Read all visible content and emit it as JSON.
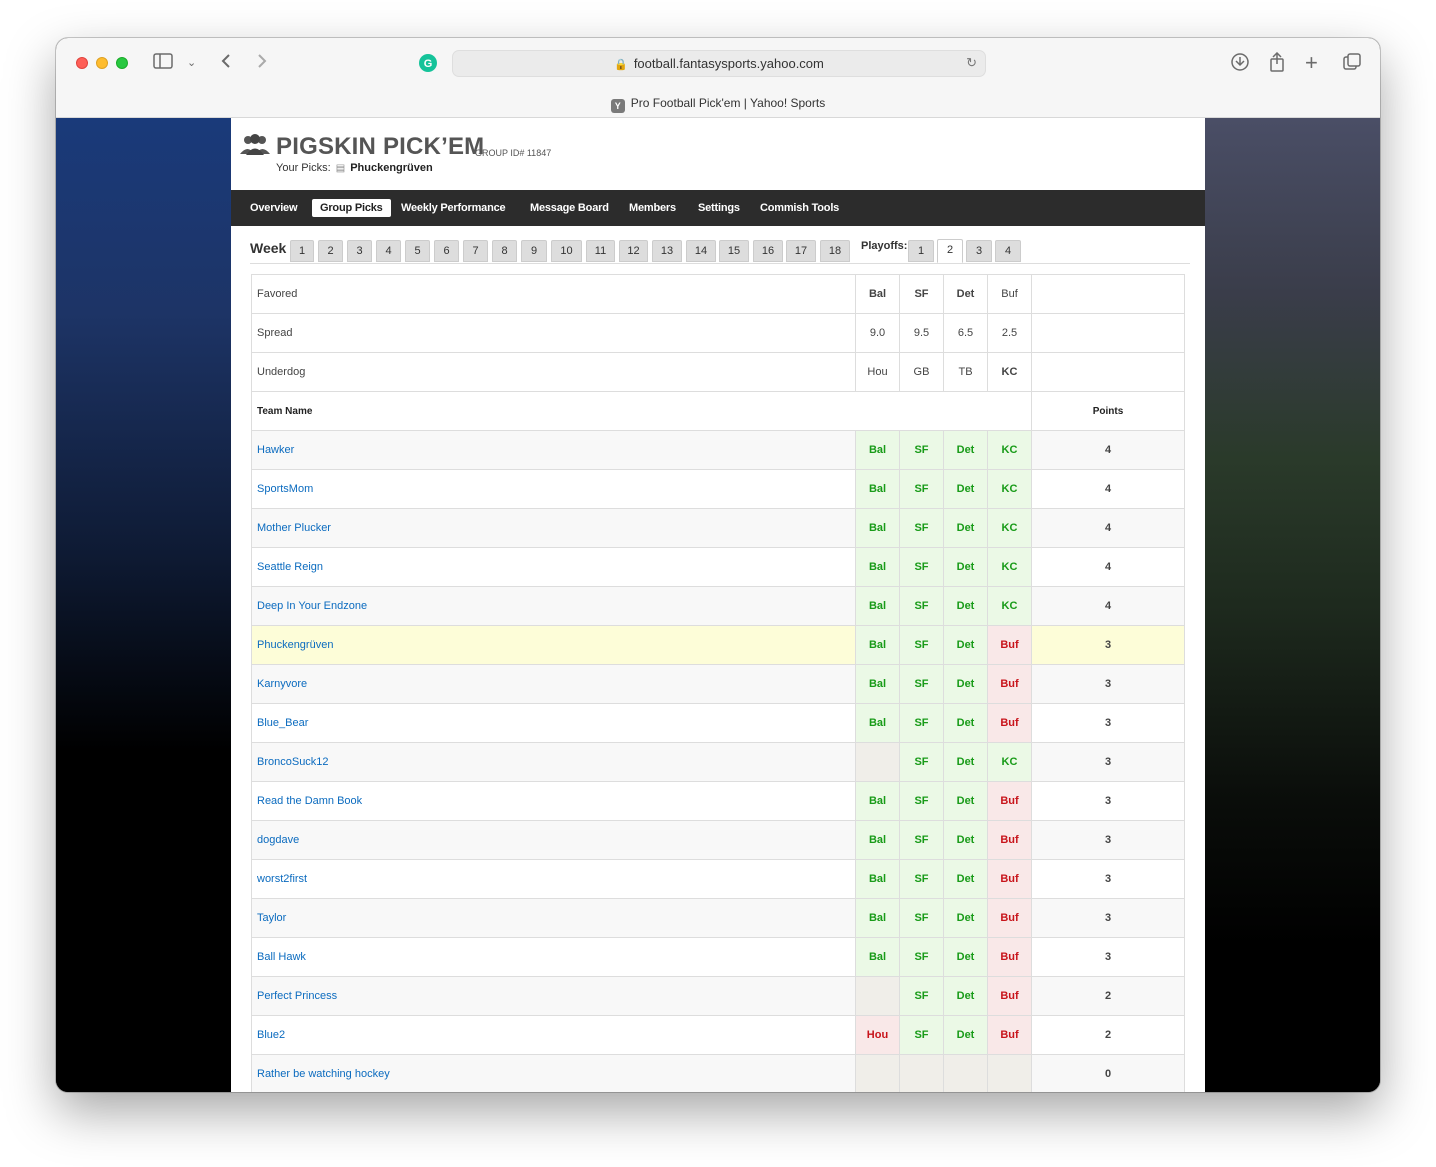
{
  "browser": {
    "url": "football.fantasysports.yahoo.com",
    "tab_title": "Pro Football Pick'em | Yahoo! Sports",
    "favicon_letter": "Y"
  },
  "header": {
    "brand": "PIGSKIN PICK’EM",
    "group_id": "GROUP ID# 11847",
    "your_picks_label": "Your Picks:",
    "your_picks_team": "Phuckengrüven"
  },
  "nav": [
    {
      "label": "Overview",
      "active": false
    },
    {
      "label": "Group Picks",
      "active": true
    },
    {
      "label": "Weekly Performance",
      "active": false
    },
    {
      "label": "Message Board",
      "active": false
    },
    {
      "label": "Members",
      "active": false
    },
    {
      "label": "Settings",
      "active": false
    },
    {
      "label": "Commish Tools",
      "active": false
    }
  ],
  "weeks": {
    "label": "Week",
    "items": [
      "1",
      "2",
      "3",
      "4",
      "5",
      "6",
      "7",
      "8",
      "9",
      "10",
      "11",
      "12",
      "13",
      "14",
      "15",
      "16",
      "17",
      "18"
    ],
    "playoffs_label": "Playoffs:",
    "playoffs": [
      "1",
      "2",
      "3",
      "4"
    ],
    "active_playoff": "2"
  },
  "matchups": {
    "favored_label": "Favored",
    "spread_label": "Spread",
    "underdog_label": "Underdog",
    "favored": [
      "Bal",
      "SF",
      "Det",
      "Buf"
    ],
    "spread": [
      "9.0",
      "9.5",
      "6.5",
      "2.5"
    ],
    "underdog": [
      "Hou",
      "GB",
      "TB",
      "KC"
    ]
  },
  "table": {
    "team_header": "Team Name",
    "points_header": "Points",
    "rows": [
      {
        "name": "Hawker",
        "picks": [
          "Bal",
          "SF",
          "Det",
          "KC"
        ],
        "results": [
          "win",
          "win",
          "win",
          "win"
        ],
        "points": "4"
      },
      {
        "name": "SportsMom",
        "picks": [
          "Bal",
          "SF",
          "Det",
          "KC"
        ],
        "results": [
          "win",
          "win",
          "win",
          "win"
        ],
        "points": "4"
      },
      {
        "name": "Mother Plucker",
        "picks": [
          "Bal",
          "SF",
          "Det",
          "KC"
        ],
        "results": [
          "win",
          "win",
          "win",
          "win"
        ],
        "points": "4"
      },
      {
        "name": "Seattle Reign",
        "picks": [
          "Bal",
          "SF",
          "Det",
          "KC"
        ],
        "results": [
          "win",
          "win",
          "win",
          "win"
        ],
        "points": "4"
      },
      {
        "name": "Deep In Your Endzone",
        "picks": [
          "Bal",
          "SF",
          "Det",
          "KC"
        ],
        "results": [
          "win",
          "win",
          "win",
          "win"
        ],
        "points": "4"
      },
      {
        "name": "Phuckengrüven",
        "picks": [
          "Bal",
          "SF",
          "Det",
          "Buf"
        ],
        "results": [
          "win",
          "win",
          "win",
          "lose"
        ],
        "points": "3",
        "me": true
      },
      {
        "name": "Karnyvore",
        "picks": [
          "Bal",
          "SF",
          "Det",
          "Buf"
        ],
        "results": [
          "win",
          "win",
          "win",
          "lose"
        ],
        "points": "3"
      },
      {
        "name": "Blue_Bear",
        "picks": [
          "Bal",
          "SF",
          "Det",
          "Buf"
        ],
        "results": [
          "win",
          "win",
          "win",
          "lose"
        ],
        "points": "3"
      },
      {
        "name": "BroncoSuck12",
        "picks": [
          "",
          "SF",
          "Det",
          "KC"
        ],
        "results": [
          "none",
          "win",
          "win",
          "win"
        ],
        "points": "3"
      },
      {
        "name": "Read the Damn Book",
        "picks": [
          "Bal",
          "SF",
          "Det",
          "Buf"
        ],
        "results": [
          "win",
          "win",
          "win",
          "lose"
        ],
        "points": "3"
      },
      {
        "name": "dogdave",
        "picks": [
          "Bal",
          "SF",
          "Det",
          "Buf"
        ],
        "results": [
          "win",
          "win",
          "win",
          "lose"
        ],
        "points": "3"
      },
      {
        "name": "worst2first",
        "picks": [
          "Bal",
          "SF",
          "Det",
          "Buf"
        ],
        "results": [
          "win",
          "win",
          "win",
          "lose"
        ],
        "points": "3"
      },
      {
        "name": "Taylor",
        "picks": [
          "Bal",
          "SF",
          "Det",
          "Buf"
        ],
        "results": [
          "win",
          "win",
          "win",
          "lose"
        ],
        "points": "3"
      },
      {
        "name": "Ball Hawk",
        "picks": [
          "Bal",
          "SF",
          "Det",
          "Buf"
        ],
        "results": [
          "win",
          "win",
          "win",
          "lose"
        ],
        "points": "3"
      },
      {
        "name": "Perfect Princess",
        "picks": [
          "",
          "SF",
          "Det",
          "Buf"
        ],
        "results": [
          "none",
          "win",
          "win",
          "lose"
        ],
        "points": "2"
      },
      {
        "name": "Blue2",
        "picks": [
          "Hou",
          "SF",
          "Det",
          "Buf"
        ],
        "results": [
          "lose",
          "win",
          "win",
          "lose"
        ],
        "points": "2"
      },
      {
        "name": "Rather be watching hockey",
        "picks": [
          "",
          "",
          "",
          ""
        ],
        "results": [
          "none",
          "none",
          "none",
          "none"
        ],
        "points": "0"
      }
    ]
  },
  "colors": {
    "win_text": "#189b18",
    "lose_text": "#c8141b",
    "link": "#0b6bbf",
    "nav_bg": "#2c2c2c",
    "my_row_bg": "#fdfdd8"
  }
}
